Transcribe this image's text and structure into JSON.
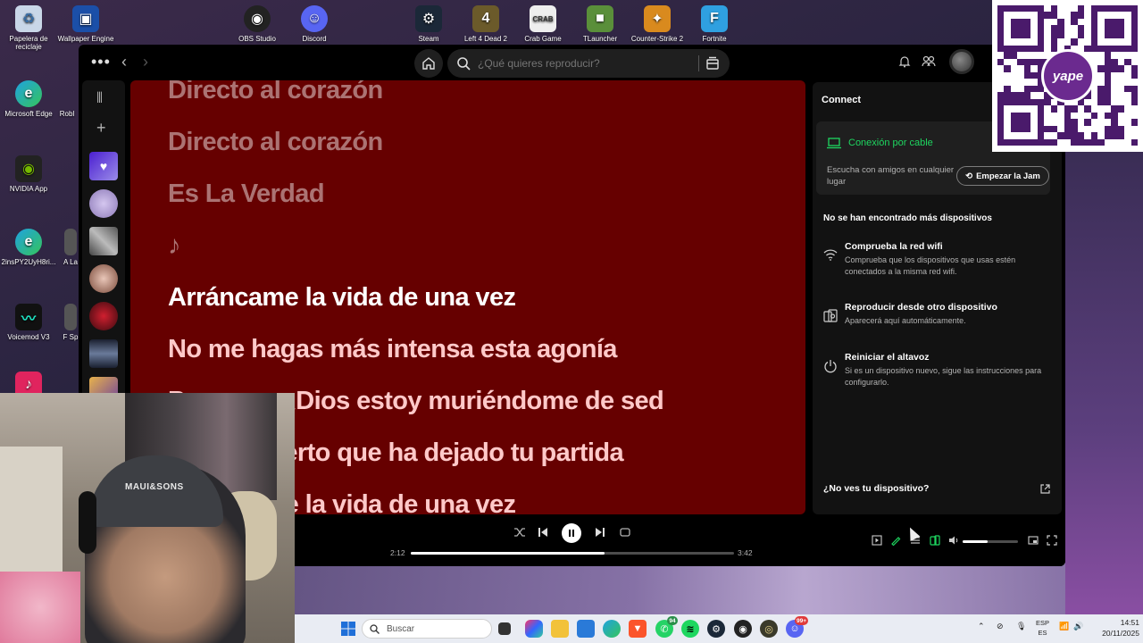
{
  "desktop": {
    "icons": [
      {
        "label": "Papelera de reciclaje",
        "icon": "recycle-bin-icon"
      },
      {
        "label": "Wallpaper Engine",
        "icon": "wallpaper-engine-icon"
      },
      {
        "label": "OBS Studio",
        "icon": "obs-icon"
      },
      {
        "label": "Discord",
        "icon": "discord-icon"
      },
      {
        "label": "Steam",
        "icon": "steam-icon"
      },
      {
        "label": "Left 4 Dead 2",
        "icon": "left4dead-icon"
      },
      {
        "label": "Crab Game",
        "icon": "crab-game-icon"
      },
      {
        "label": "TLauncher",
        "icon": "tlauncher-icon"
      },
      {
        "label": "Counter-Strike 2",
        "icon": "cs2-icon"
      },
      {
        "label": "Fortnite",
        "icon": "fortnite-icon"
      },
      {
        "label": "Microsoft Edge",
        "icon": "edge-icon"
      },
      {
        "label": "Robl",
        "icon": "roblox-icon"
      },
      {
        "label": "NVIDIA App",
        "icon": "nvidia-icon"
      },
      {
        "label": "2insPY2UyH8ri...",
        "icon": "edge-icon"
      },
      {
        "label": "A La",
        "icon": "app-icon"
      },
      {
        "label": "Voicemod V3",
        "icon": "voicemod-icon"
      },
      {
        "label": "F Sp",
        "icon": "app-icon"
      }
    ]
  },
  "spotify": {
    "topbar": {
      "menu": "•••",
      "search_placeholder": "¿Qué quieres reproducir?"
    },
    "lyrics": [
      {
        "text": "Directo al corazón",
        "state": "past"
      },
      {
        "text": "Directo al corazón",
        "state": "past"
      },
      {
        "text": "Es La Verdad",
        "state": "past"
      },
      {
        "text": "♪",
        "state": "past"
      },
      {
        "text": "Arráncame la vida de una vez",
        "state": "current"
      },
      {
        "text": "No me hagas más intensa esta agonía",
        "state": "future"
      },
      {
        "text": "Porque... ¿Dios estoy muriéndome de sed",
        "state": "future"
      },
      {
        "text": "En el desierto que ha dejado tu partida",
        "state": "future"
      },
      {
        "text": "Arráncame la vida de una vez",
        "state": "future"
      }
    ],
    "connect": {
      "title": "Connect",
      "current_device": "Conexión por cable",
      "jam_text": "Escucha con amigos en cualquier lugar",
      "jam_button": "Empezar la Jam",
      "no_devices": "No se han encontrado más dispositivos",
      "tips": [
        {
          "icon": "wifi-icon",
          "title": "Comprueba la red wifi",
          "desc": "Comprueba que los dispositivos que usas estén conectados a la misma red wifi."
        },
        {
          "icon": "other-device-icon",
          "title": "Reproducir desde otro dispositivo",
          "desc": "Aparecerá aquí automáticamente."
        },
        {
          "icon": "power-icon",
          "title": "Reiniciar el altavoz",
          "desc": "Si es un dispositivo nuevo, sigue las instrucciones para configurarlo."
        }
      ],
      "no_see": "¿No ves tu dispositivo?"
    },
    "player": {
      "elapsed": "2:12",
      "duration": "3:42",
      "progress": 0.6,
      "volume": 0.45,
      "accent": "#1ed760"
    }
  },
  "webcam": {
    "cap_text": "MAUI&SONS"
  },
  "qr": {
    "brand": "yape"
  },
  "taskbar": {
    "search_placeholder": "Buscar",
    "whatsapp_badge": "94",
    "discord_badge": "99+",
    "lang_top": "ESP",
    "lang_bottom": "ES",
    "time": "14:51",
    "date": "20/11/2025"
  }
}
